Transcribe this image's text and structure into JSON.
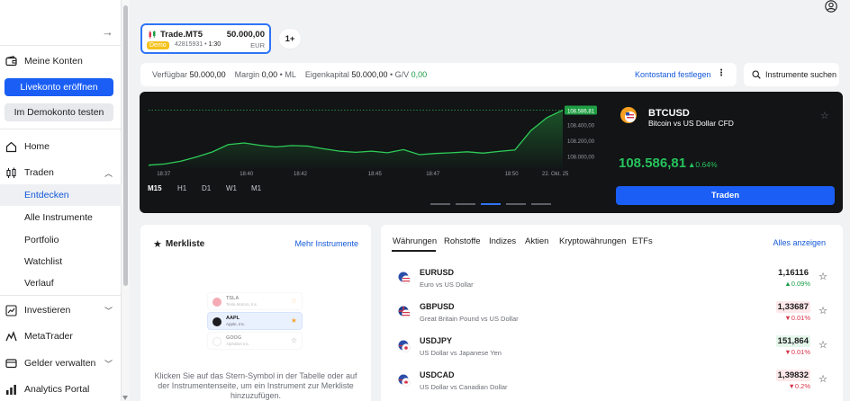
{
  "sidebar": {
    "items": {
      "meine_konten": "Meine Konten",
      "home": "Home",
      "traden": "Traden",
      "investieren": "Investieren",
      "metatrader": "MetaTrader",
      "gelder": "Gelder verwalten",
      "analytics": "Analytics Portal"
    },
    "sub_items": [
      "Entdecken",
      "Alle Instrumente",
      "Portfolio",
      "Watchlist",
      "Verlauf"
    ],
    "live_button": "Livekonto eröffnen",
    "demo_button": "Im Demokonto testen"
  },
  "account": {
    "name": "Trade.MT5",
    "balance": "50.000,00",
    "badge": "Demo",
    "number": "42815931",
    "leverage": "1:30",
    "currency": "EUR",
    "more": "1+"
  },
  "infobar": {
    "verfuegbar_label": "Verfügbar",
    "verfuegbar_value": "50.000,00",
    "margin_label": "Margin",
    "margin_value": "0,00",
    "ml": "ML",
    "eigenkapital_label": "Eigenkapital",
    "eigenkapital_value": "50.000,00",
    "gv_label": "G/V",
    "gv_value": "0,00",
    "kontostand": "Kontostand festlegen",
    "more": "⋮"
  },
  "search": {
    "placeholder": "Instrumente suchen"
  },
  "featured": {
    "symbol": "BTCUSD",
    "name": "Bitcoin vs US Dollar CFD",
    "price": "108.586,81",
    "change": "▲0.64%",
    "trade_button": "Traden",
    "timeframes": [
      "M15",
      "H1",
      "D1",
      "W1",
      "M1"
    ],
    "active_timeframe": "M15"
  },
  "chart_data": {
    "type": "area",
    "x": [
      "18:37",
      "18:40",
      "18:42",
      "18:45",
      "18:47",
      "18:50",
      "22. Okt. 25"
    ],
    "y_ticks": [
      "108.586,81",
      "108.400,00",
      "108.200,00",
      "108.000,00"
    ],
    "ylim": [
      107900,
      108650
    ],
    "current_value": 108586.81,
    "series": [
      {
        "values": [
          107880,
          107895,
          107930,
          107985,
          108050,
          108145,
          108165,
          108135,
          108115,
          108132,
          108125,
          108090,
          108060,
          108045,
          108060,
          108040,
          108080,
          108015,
          108030,
          108040,
          108052,
          108035,
          108057,
          108075,
          108325,
          108490,
          108586.81
        ]
      }
    ],
    "colors": {
      "line": "#2ecc57",
      "fill": "#1c5e2c",
      "label_bg": "#1f9e43"
    }
  },
  "watchlist": {
    "title": "Merkliste",
    "more": "Mehr Instrumente",
    "help": "Klicken Sie auf das Stern-Symbol in der Tabelle oder auf der Instrumentenseite, um ein Instrument zur Merkliste hinzuzufügen.",
    "illustration": [
      {
        "sym": "TSLA",
        "name": "Tesla Motors, Inc."
      },
      {
        "sym": "AAPL",
        "name": "Apple, Inc."
      },
      {
        "sym": "GOOG",
        "name": "Alphabet Inc."
      }
    ]
  },
  "markets": {
    "tabs": [
      "Währungen",
      "Rohstoffe",
      "Indizes",
      "Aktien",
      "Kryptowährungen",
      "ETFs"
    ],
    "active_tab": "Währungen",
    "all": "Alles anzeigen",
    "rows": [
      {
        "sym": "EURUSD",
        "desc": "Euro vs US Dollar",
        "price": "1,16116",
        "change": "▲0.09%",
        "dir": "up",
        "bg": "flat"
      },
      {
        "sym": "GBPUSD",
        "desc": "Great Britain Pound vs US Dollar",
        "price": "1,33687",
        "change": "▼0.01%",
        "dir": "down",
        "bg": "down"
      },
      {
        "sym": "USDJPY",
        "desc": "US Dollar vs Japanese Yen",
        "price": "151,864",
        "change": "▼0.01%",
        "dir": "down",
        "bg": "up"
      },
      {
        "sym": "USDCAD",
        "desc": "US Dollar vs Canadian Dollar",
        "price": "1,39832",
        "change": "▼0.2%",
        "dir": "down",
        "bg": "down"
      }
    ]
  }
}
